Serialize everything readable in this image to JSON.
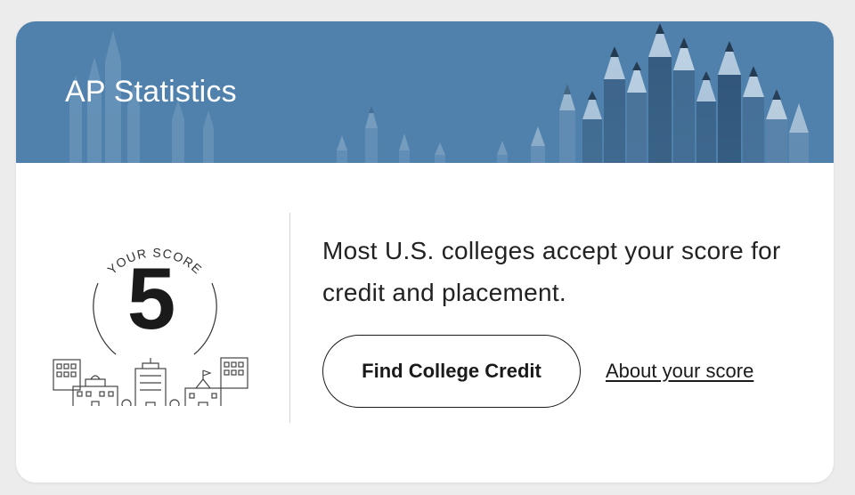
{
  "card": {
    "title": "AP Statistics",
    "banner_color": "#4f81ac"
  },
  "score": {
    "label": "YOUR SCORE",
    "value": "5",
    "illustration": "college-buildings-icon"
  },
  "message": {
    "text": "Most U.S. colleges accept your score for credit and placement."
  },
  "actions": {
    "find_college_credit_label": "Find College Credit",
    "about_score_label": "About your score"
  }
}
